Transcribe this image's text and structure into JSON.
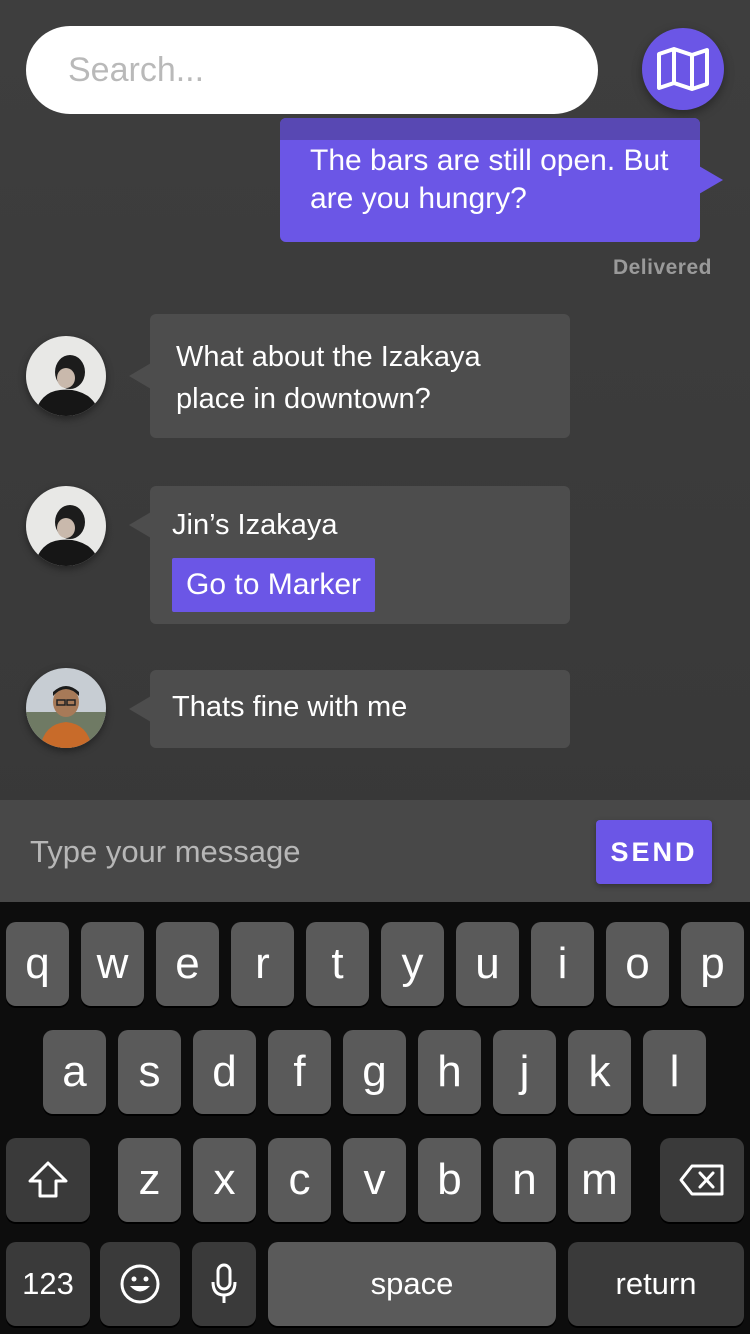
{
  "search": {
    "placeholder": "Search..."
  },
  "map_button": {
    "icon": "map-icon"
  },
  "messages": {
    "outgoing": {
      "text": "The bars are still open. But are you hungry?",
      "status": "Delivered"
    },
    "incoming": [
      {
        "text": "What about the Izakaya place in downtown?",
        "avatar": "avatar-person-dark-sweater"
      },
      {
        "text": "Jin’s Izakaya",
        "button_label": "Go to Marker",
        "avatar": "avatar-person-dark-sweater"
      },
      {
        "text": "Thats fine with me",
        "avatar": "avatar-person-glasses-orange-shirt"
      }
    ]
  },
  "composer": {
    "placeholder": "Type your message",
    "send_label": "SEND"
  },
  "keyboard": {
    "row1": [
      "q",
      "w",
      "e",
      "r",
      "t",
      "y",
      "u",
      "i",
      "o",
      "p"
    ],
    "row2": [
      "a",
      "s",
      "d",
      "f",
      "g",
      "h",
      "j",
      "k",
      "l"
    ],
    "row3": [
      "z",
      "x",
      "c",
      "v",
      "b",
      "n",
      "m"
    ],
    "shift_icon": "shift-icon",
    "delete_icon": "delete-icon",
    "numbers_label": "123",
    "emoji_icon": "emoji-icon",
    "mic_icon": "microphone-icon",
    "space_label": "space",
    "return_label": "return"
  },
  "colors": {
    "accent": "#6b56e6",
    "background": "#3b3b3b",
    "bubble_in": "#4d4d4d",
    "keyboard_bg": "#0d0d0d",
    "key": "#5a5a5a",
    "key_dark": "#3a3a3a"
  }
}
